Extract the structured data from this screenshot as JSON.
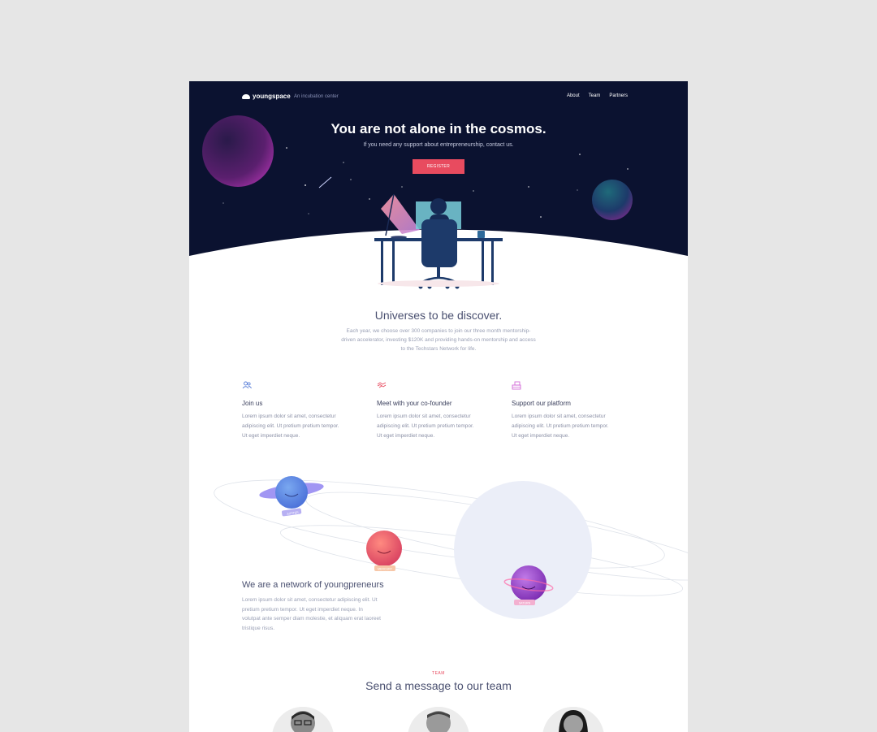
{
  "nav": {
    "logo_text": "youngspace",
    "tagline": "An incubation center",
    "links": [
      "About",
      "Team",
      "Partners"
    ]
  },
  "hero": {
    "title": "You are not alone in the cosmos.",
    "subtitle": "If you need any support about entrepreneurship, contact us.",
    "cta": "REGISTER"
  },
  "discover": {
    "title": "Universes to be discover.",
    "text": "Each year, we choose over 300 companies to join our three month mentorship-driven accelerator, investing $120K and providing hands-on mentorship and access to the Techstars Network for life."
  },
  "features": [
    {
      "icon": "people-icon",
      "title": "Join us",
      "text": "Lorem ipsum dolor sit amet, consectetur adipiscing elit. Ut pretium pretium tempor. Ut eget imperdiet neque."
    },
    {
      "icon": "handshake-icon",
      "title": "Meet with your co-founder",
      "text": "Lorem ipsum dolor sit amet, consectetur adipiscing elit. Ut pretium pretium tempor. Ut eget imperdiet neque."
    },
    {
      "icon": "platform-icon",
      "title": "Support our platform",
      "text": "Lorem ipsum dolor sit amet, consectetur adipiscing elit. Ut pretium pretium tempor. Ut eget imperdiet neque."
    }
  ],
  "planets": [
    "JUPITER",
    "MERCURY",
    "SATURN"
  ],
  "network": {
    "title": "We are a network of youngpreneurs",
    "text": "Lorem ipsum dolor sit amet, consectetur adipiscing elit. Ut pretium pretium tempor. Ut eget imperdiet neque. In volutpat ante semper diam molestie, et aliquam erat laoreet tristique risus."
  },
  "team": {
    "kicker": "TEAM",
    "title": "Send a message to our team"
  },
  "colors": {
    "accent": "#e84b5f",
    "hero_bg": "#0b1230",
    "text_dark": "#4a5070"
  }
}
